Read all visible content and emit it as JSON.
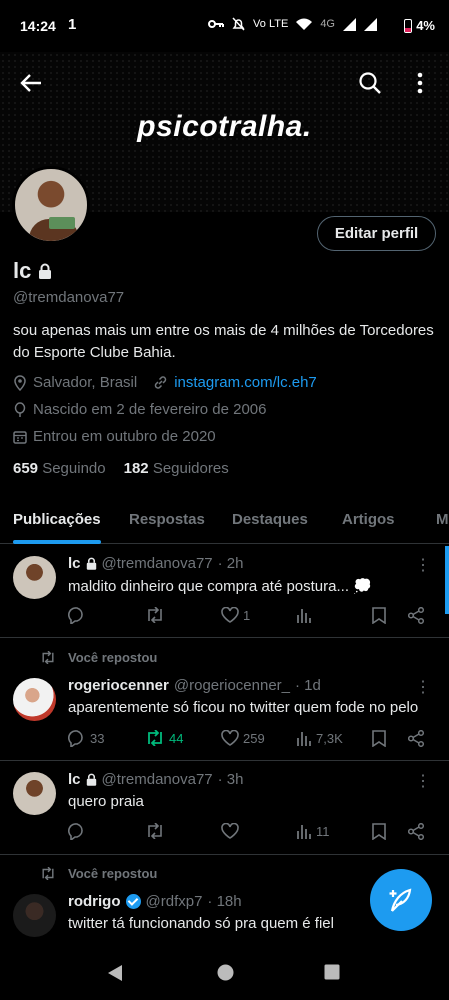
{
  "status_bar": {
    "time": "14:24",
    "notification": "1",
    "network": "4G",
    "battery": "4%"
  },
  "banner": {
    "title": "psicotralha."
  },
  "header": {
    "edit_label": "Editar perfil"
  },
  "profile": {
    "name": "lc",
    "handle": "@tremdanova77",
    "bio_line1": "sou apenas mais um entre os mais de 4 milhões de Torcedores",
    "bio_line2": "do Esporte Clube Bahia.",
    "location": "Salvador, Brasil",
    "link": "instagram.com/lc.eh7",
    "birth": "Nascido em 2 de fevereiro de 2006",
    "joined": "Entrou em outubro de 2020",
    "following_count": "659",
    "following_label": "Seguindo",
    "followers_count": "182",
    "followers_label": "Seguidores"
  },
  "tabs": [
    "Publicações",
    "Respostas",
    "Destaques",
    "Artigos",
    "M"
  ],
  "posts": [
    {
      "name": "lc",
      "handle": "@tremdanova77",
      "time": "· 2h",
      "text": "maldito dinheiro que compra até postura...",
      "likes": "1"
    },
    {
      "repost_label": "Você repostou",
      "name": "rogeriocenner",
      "handle": "@rogeriocenner_",
      "time": "· 1d",
      "text": "aparentemente só ficou no twitter quem fode no pelo",
      "replies": "33",
      "reposts": "44",
      "likes": "259",
      "views": "7,3K"
    },
    {
      "name": "lc",
      "handle": "@tremdanova77",
      "time": "· 3h",
      "text": "quero praia",
      "views": "11"
    },
    {
      "repost_label": "Você repostou",
      "name": "rodrigo",
      "handle": "@rdfxp7",
      "time": "· 18h",
      "text": "twitter tá funcionando só pra quem é fiel"
    }
  ],
  "colors": {
    "accent": "#1d9bf0",
    "repost_green": "#00ba7c",
    "muted": "#71767b",
    "text": "#e7e9ea"
  }
}
